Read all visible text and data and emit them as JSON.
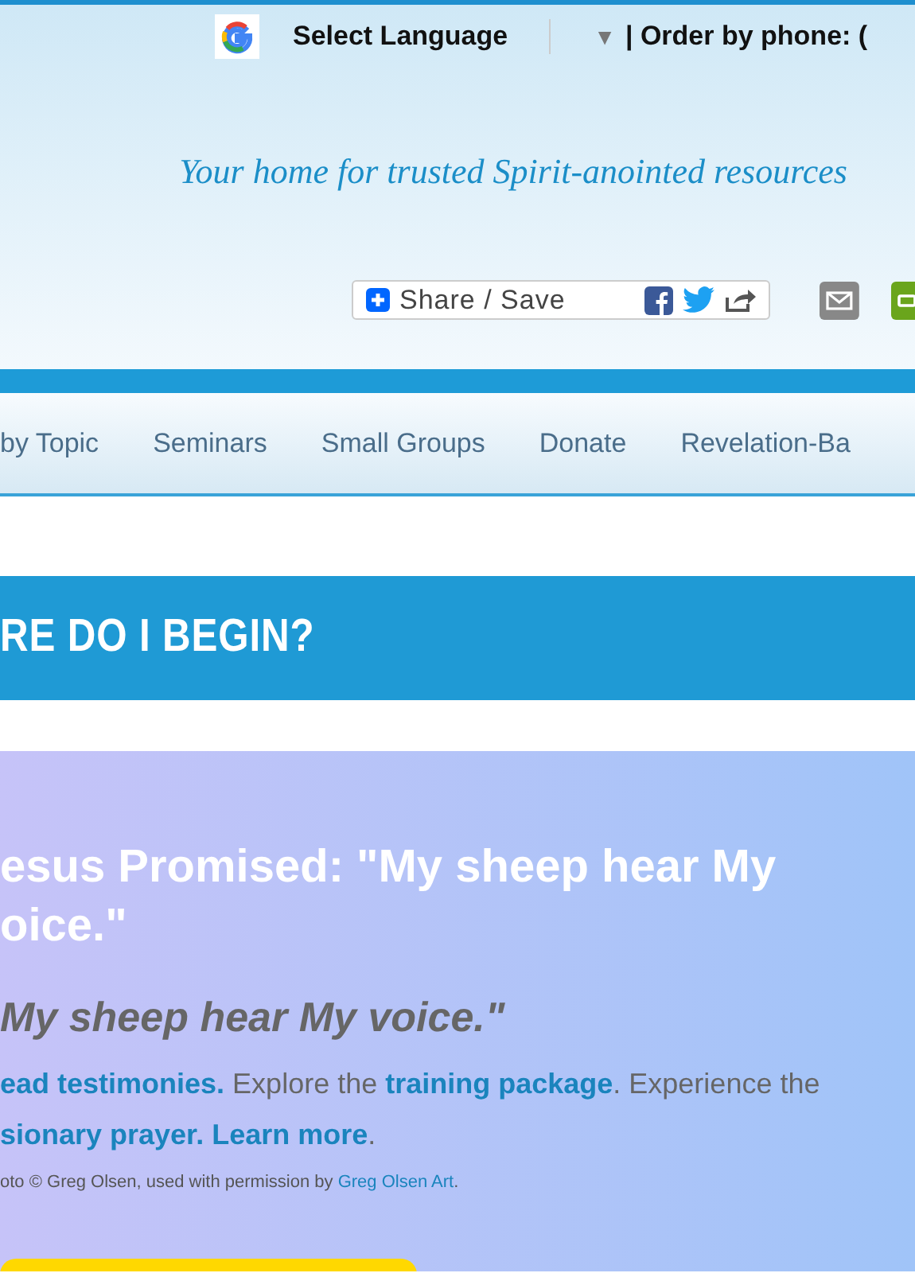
{
  "top_bar": {
    "language": "Select Language",
    "dropdown": "▼",
    "order": "| Order by phone: ("
  },
  "tagline": "Your home for trusted Spirit-anointed resources",
  "share": {
    "label": "Share / Save"
  },
  "nav": [
    {
      "label": "by Topic"
    },
    {
      "label": "Seminars"
    },
    {
      "label": "Small Groups"
    },
    {
      "label": "Donate"
    },
    {
      "label": "Revelation-Ba"
    }
  ],
  "section_heading": "RE DO I BEGIN?",
  "hero": {
    "heading_lines": [
      "esus Promised: \"My sheep hear My",
      "oice.\""
    ],
    "quote": "My sheep hear My voice.\"",
    "paragraph_lines": [
      [
        {
          "kind": "link",
          "text": "ead testimonies."
        },
        {
          "kind": "text",
          "text": " Explore the "
        },
        {
          "kind": "link",
          "text": "training package"
        },
        {
          "kind": "text",
          "text": ". Experience the"
        }
      ],
      [
        {
          "kind": "link",
          "text": "sionary prayer."
        },
        {
          "kind": "link",
          "text": "Learn more"
        },
        {
          "kind": "text",
          "text": "."
        }
      ]
    ],
    "credit": [
      {
        "kind": "text",
        "text": "oto © Greg Olsen, used with permission by "
      },
      {
        "kind": "link",
        "text": "Greg Olsen Art"
      },
      {
        "kind": "text",
        "text": "."
      }
    ]
  }
}
